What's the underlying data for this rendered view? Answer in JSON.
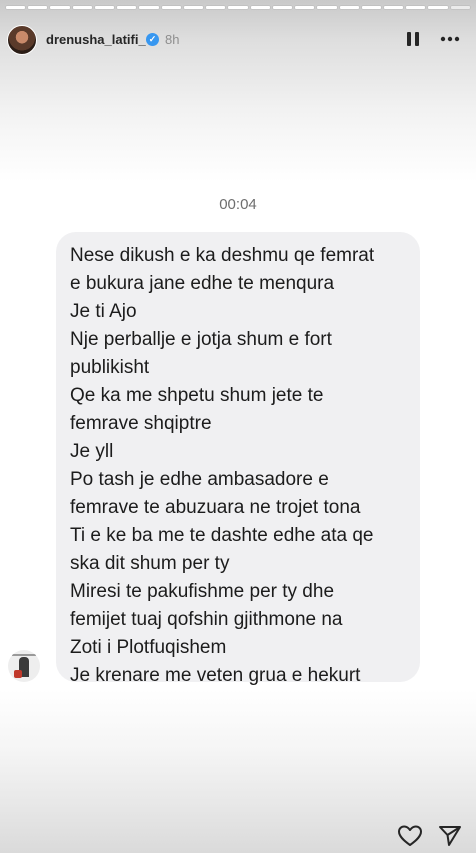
{
  "story": {
    "progress_segments": 21,
    "progress_done": 20
  },
  "header": {
    "username": "drenusha_latifi_",
    "verified_glyph": "✓",
    "time_ago": "8h",
    "pause_icon": "pause-icon",
    "more_icon": "more-icon"
  },
  "chat": {
    "timestamp": "00:04",
    "message_lines": [
      "Nese dikush e ka deshmu qe femrat",
      "e bukura jane edhe te menqura",
      "Je ti Ajo",
      "Nje perballje e jotja shum e fort",
      "publikisht",
      "Qe ka me shpetu shum jete te",
      "femrave shqiptre",
      "Je yll",
      "Po tash je edhe ambasadore e",
      "femrave te abuzuara ne trojet tona",
      "Ti e ke ba me te dashte edhe ata qe",
      "ska dit shum per ty",
      "Miresi te pakufishme per ty dhe",
      "femijet tuaj qofshin gjithmone na",
      "Zoti i Plotfuqishem",
      "Je krenare me veten grua e hekurt"
    ]
  },
  "footer": {
    "like_icon": "heart-icon",
    "share_icon": "send-icon"
  }
}
